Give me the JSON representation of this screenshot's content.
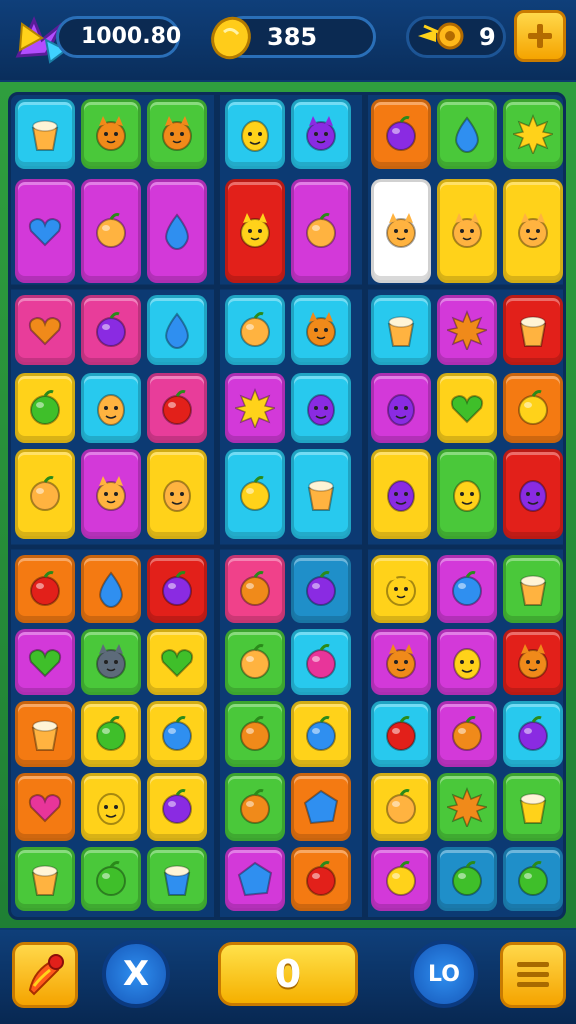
{
  "hud": {
    "score": "1000.80",
    "coins": "385",
    "moves_count": "9",
    "icons": {
      "logo": "star-burst-icon",
      "coin": "gold-coin-icon",
      "powerup": "comet-icon",
      "add": "plus-icon"
    }
  },
  "controls": {
    "cancel_label": "X",
    "center_value": "0",
    "level_label": "LO",
    "icons": {
      "booster": "pepper-booster-icon",
      "cancel": "close-icon",
      "menu": "menu-icon"
    }
  },
  "colors": {
    "hud_bg": "#0a2e5c",
    "board_frame": "#2f9e3e",
    "accent": "#ffd000"
  },
  "board": {
    "rows": [
      [
        {
          "bg": "#28c9ee",
          "icon": "ice-cream-icon"
        },
        {
          "bg": "#4ac83a",
          "icon": "orange-cat-icon"
        },
        {
          "bg": "#4ac83a",
          "icon": "orange-bear-icon"
        },
        {
          "bg": "#28c9ee",
          "icon": "yellow-blob-icon"
        },
        {
          "bg": "#28c9ee",
          "icon": "purple-cat-icon"
        },
        {
          "bg": "#f47a12",
          "icon": "purple-berry-icon"
        },
        {
          "bg": "#4ac83a",
          "icon": "blue-drop-icon"
        },
        {
          "bg": "#4ac83a",
          "icon": "yellow-sun-icon"
        }
      ],
      [
        {
          "bg": "#d339d9",
          "icon": "blue-cat-heart-icon"
        },
        {
          "bg": "#d339d9",
          "icon": "apple-leaf-icon"
        },
        {
          "bg": "#d339d9",
          "icon": "blue-drop-tall-icon"
        },
        {
          "bg": "#e2201a",
          "icon": "yellow-cat-splat-icon"
        },
        {
          "bg": "#d339d9",
          "icon": "eggplant-icon"
        },
        {
          "bg": "#ffffff",
          "icon": "avocado-bear-icon"
        },
        {
          "bg": "#ffd21a",
          "icon": "bear-faces-icon"
        },
        {
          "bg": "#ffd21a",
          "icon": "bear-apple-icon"
        }
      ],
      [
        {
          "bg": "#e83d9a",
          "icon": "orange-heart-icon"
        },
        {
          "bg": "#e83d9a",
          "icon": "purple-berry-icon"
        },
        {
          "bg": "#28c9ee",
          "icon": "blue-drop-icon"
        },
        {
          "bg": "#28c9ee",
          "icon": "cracker-icon"
        },
        {
          "bg": "#28c9ee",
          "icon": "orange-cat-icon"
        },
        {
          "bg": "#28c9ee",
          "icon": "ice-cream-cup-icon"
        },
        {
          "bg": "#d339d9",
          "icon": "orange-sun-icon"
        },
        {
          "bg": "#e2201a",
          "icon": "flower-pot-icon"
        }
      ],
      [
        {
          "bg": "#ffd21a",
          "icon": "green-apple-icon"
        },
        {
          "bg": "#28c9ee",
          "icon": "ghost-icon"
        },
        {
          "bg": "#e83d9a",
          "icon": "red-apple-icon"
        },
        {
          "bg": "#d339d9",
          "icon": "yellow-sun-icon"
        },
        {
          "bg": "#28c9ee",
          "icon": "purple-face-icon"
        },
        {
          "bg": "#d339d9",
          "icon": "purple-face-icon"
        },
        {
          "bg": "#ffd21a",
          "icon": "green-heart-icon"
        },
        {
          "bg": "#f47a12",
          "icon": "yellow-lemon-icon"
        }
      ],
      [
        {
          "bg": "#ffd21a",
          "icon": "bottle-icon"
        },
        {
          "bg": "#d339d9",
          "icon": "lion-icon"
        },
        {
          "bg": "#ffd21a",
          "icon": "boy-face-icon"
        },
        {
          "bg": "#28c9ee",
          "icon": "yellow-banana-icon"
        },
        {
          "bg": "#28c9ee",
          "icon": "ice-cream-cone-icon"
        },
        {
          "bg": "#ffd21a",
          "icon": "purple-ghost-icon"
        },
        {
          "bg": "#4ac83a",
          "icon": "yellow-boy-icon"
        },
        {
          "bg": "#e2201a",
          "icon": "purple-robot-icon"
        }
      ],
      [
        {
          "bg": "#f47a12",
          "icon": "red-apple-icon"
        },
        {
          "bg": "#f47a12",
          "icon": "blue-drop-icon"
        },
        {
          "bg": "#e2201a",
          "icon": "purple-berry-icon"
        },
        {
          "bg": "#f0418a",
          "icon": "orange-fruit-icon"
        },
        {
          "bg": "#1f8fc9",
          "icon": "purple-shell-icon"
        },
        {
          "bg": "#ffd21a",
          "icon": "yellow-bear-icon"
        },
        {
          "bg": "#d339d9",
          "icon": "blue-orb-icon"
        },
        {
          "bg": "#4ac83a",
          "icon": "flower-pot-icon"
        }
      ],
      [
        {
          "bg": "#d339d9",
          "icon": "green-heart-icon"
        },
        {
          "bg": "#4ac83a",
          "icon": "gray-cat-icon"
        },
        {
          "bg": "#ffd21a",
          "icon": "green-heart-icon"
        },
        {
          "bg": "#4ac83a",
          "icon": "cinnamon-roll-icon"
        },
        {
          "bg": "#28c9ee",
          "icon": "magenta-berry-icon"
        },
        {
          "bg": "#d339d9",
          "icon": "orange-bear-icon"
        },
        {
          "bg": "#d339d9",
          "icon": "yellow-face-icon"
        },
        {
          "bg": "#e2201a",
          "icon": "orange-cat-icon"
        }
      ],
      [
        {
          "bg": "#f47a12",
          "icon": "cake-cup-icon"
        },
        {
          "bg": "#ffd21a",
          "icon": "green-apple-icon"
        },
        {
          "bg": "#ffd21a",
          "icon": "blue-swirl-icon"
        },
        {
          "bg": "#4ac83a",
          "icon": "orange-lemon-icon"
        },
        {
          "bg": "#ffd21a",
          "icon": "blue-orb-icon"
        },
        {
          "bg": "#28c9ee",
          "icon": "red-apple-icon"
        },
        {
          "bg": "#d339d9",
          "icon": "orange-cookie-icon"
        },
        {
          "bg": "#28c9ee",
          "icon": "purple-fuzz-icon"
        }
      ],
      [
        {
          "bg": "#f47a12",
          "icon": "pink-heart-icon"
        },
        {
          "bg": "#ffd21a",
          "icon": "yellow-lemon-face-icon"
        },
        {
          "bg": "#ffd21a",
          "icon": "purple-plum-icon"
        },
        {
          "bg": "#4ac83a",
          "icon": "orange-apple-icon"
        },
        {
          "bg": "#f47a12",
          "icon": "blue-gem-icon"
        },
        {
          "bg": "#ffd21a",
          "icon": "striped-ball-icon"
        },
        {
          "bg": "#4ac83a",
          "icon": "orange-sun-icon"
        },
        {
          "bg": "#4ac83a",
          "icon": "yellow-cup-icon"
        }
      ],
      [
        {
          "bg": "#4ac83a",
          "icon": "box-icon"
        },
        {
          "bg": "#4ac83a",
          "icon": "green-leaf-icon"
        },
        {
          "bg": "#4ac83a",
          "icon": "blue-cupcake-icon"
        },
        {
          "bg": "#d339d9",
          "icon": "blue-cube-icon"
        },
        {
          "bg": "#f47a12",
          "icon": "red-apple-icon"
        },
        {
          "bg": "#d339d9",
          "icon": "yellow-lemon-icon"
        },
        {
          "bg": "#1f8fc9",
          "icon": "green-apple-icon"
        },
        {
          "bg": "#1f8fc9",
          "icon": "green-apple-icon"
        }
      ]
    ]
  }
}
